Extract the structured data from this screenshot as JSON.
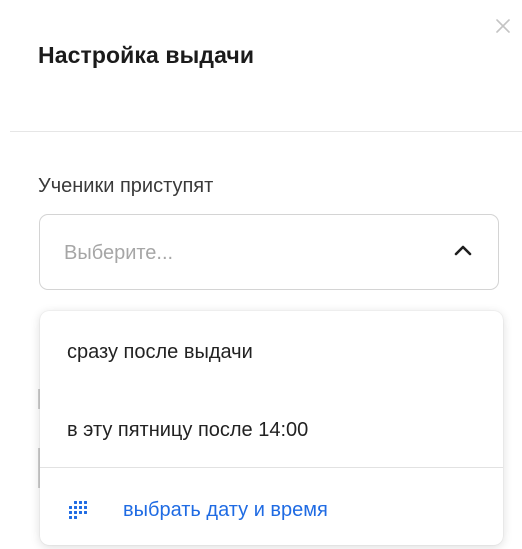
{
  "dialog": {
    "title": "Настройка выдачи",
    "close_icon": "close-icon"
  },
  "start_field": {
    "label": "Ученики приступят",
    "placeholder": "Выберите...",
    "expanded": true,
    "chevron_icon": "chevron-up-icon"
  },
  "dropdown": {
    "options": [
      {
        "label": "сразу после выдачи"
      },
      {
        "label": "в эту пятницу после 14:00"
      }
    ],
    "custom_option": {
      "label": "выбрать дату и время",
      "icon": "calendar-grid-icon"
    }
  },
  "colors": {
    "link": "#1f6be3",
    "text": "#1f1f1f",
    "placeholder": "#a6a6a6",
    "border": "#d4d4d4"
  }
}
